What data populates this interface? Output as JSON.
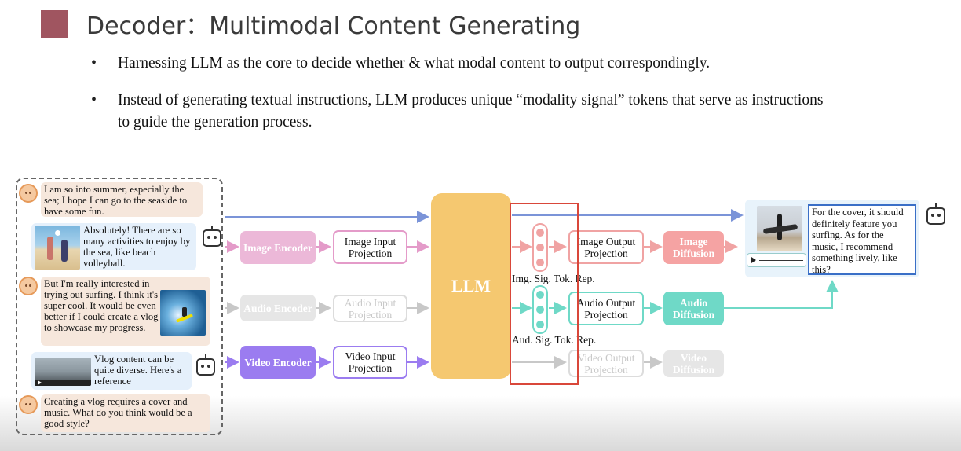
{
  "title": "Decoder：Multimodal Content Generating",
  "bullets": [
    "Harnessing LLM as the core to decide whether & what modal content to output correspondingly.",
    "Instead of generating textual instructions, LLM produces unique “modality signal” tokens that serve as instructions to guide the generation process."
  ],
  "dialog": {
    "msg1": "I am so into summer, especially the sea; I hope I can go to the seaside to have some fun.",
    "msg2": "Absolutely! There are so many activities to enjoy by the sea, like beach volleyball.",
    "msg3": "But I'm really interested in trying out surfing. I think it's super cool. It would be even better if I could create a vlog to showcase my progress.",
    "msg4": "Vlog content can be quite diverse. Here's a reference",
    "msg5": "Creating a vlog requires a cover and music. What do you think would be a good style?"
  },
  "encoders": {
    "image": "Image Encoder",
    "audio": "Audio Encoder",
    "video": "Video Encoder"
  },
  "input_projections": {
    "image": "Image Input Projection",
    "audio": "Audio Input Projection",
    "video": "Video Input Projection"
  },
  "llm_label": "LLM",
  "token_labels": {
    "image": "Img. Sig. Tok. Rep.",
    "audio": "Aud. Sig. Tok. Rep."
  },
  "output_projections": {
    "image": "Image Output Projection",
    "audio": "Audio Output Projection",
    "video": "Video Output Projection"
  },
  "diffusions": {
    "image": "Image Diffusion",
    "audio": "Audio Diffusion",
    "video": "Video Diffusion"
  },
  "output_text": "For the cover, it should definitely feature you surfing. As for the music, I recommend something lively, like this?",
  "colors": {
    "image_encoder": "#ecb8d8",
    "audio_encoder": "#e6e6e6",
    "video_encoder": "#9b7cf0",
    "image_diffusion": "#f5a3a3",
    "audio_diffusion": "#6fd9c7",
    "video_diffusion": "#e6e6e6",
    "llm": "#f5c870",
    "highlight": "#d9473a"
  },
  "icons": [
    "user-avatar-icon",
    "robot-icon",
    "play-icon"
  ]
}
